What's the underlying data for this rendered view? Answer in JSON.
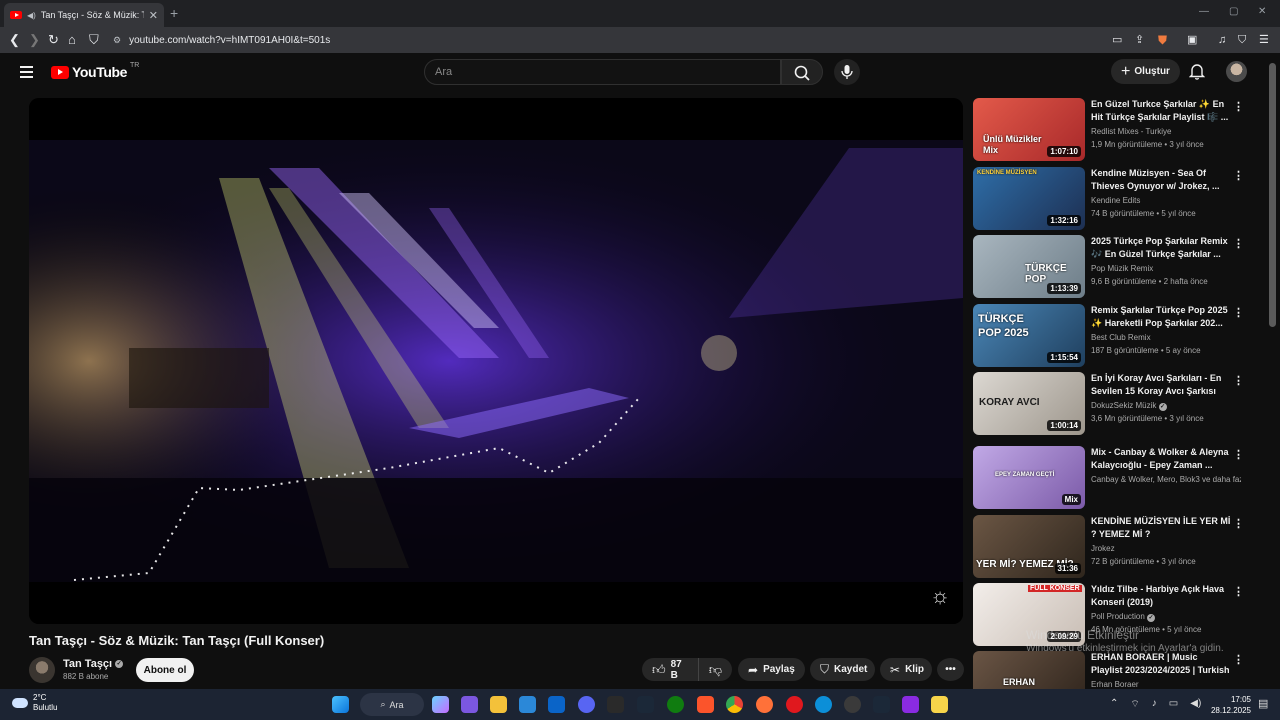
{
  "browser": {
    "tab_title": "Tan Taşçı - Söz & Müzik: Tan",
    "url": "youtube.com/watch?v=hIMT091AH0I&t=501s"
  },
  "masthead": {
    "logo_text": "YouTube",
    "country_code": "TR",
    "search_placeholder": "Ara",
    "create_label": "Oluştur"
  },
  "video": {
    "title": "Tan Taşçı - Söz & Müzik: Tan Taşçı (Full Konser)",
    "channel": "Tan Taşçı",
    "subscribers": "882 B abone",
    "subscribe_label": "Abone ol",
    "likes": "87 B",
    "share_label": "Paylaş",
    "save_label": "Kaydet",
    "clip_label": "Klip"
  },
  "recommendations": [
    {
      "title": "En Güzel Turkce Şarkılar ✨ En Hit Türkçe Şarkılar Playlist 🎼 ...",
      "channel": "Redlist Mixes - Turkiye",
      "meta": "1,9 Mn görüntüleme • 3 yıl önce",
      "duration": "1:07:10",
      "thumb_text": "Ünlü Müzikler Mix",
      "color": "#d9534f"
    },
    {
      "title": "Kendine Müzisyen - Sea Of Thieves Oynuyor w/ Jrokez, ...",
      "channel": "Kendine Edits",
      "meta": "74 B görüntüleme • 5 yıl önce",
      "duration": "1:32:16",
      "thumb_text": "KENDİNE MÜZİSYEN",
      "color": "#3a5f8a"
    },
    {
      "title": "2025 Türkçe Pop Şarkılar Remix 🎶 En Güzel Türkçe Şarkılar ...",
      "channel": "Pop Müzik Remix",
      "meta": "9,6 B görüntüleme • 2 hafta önce",
      "duration": "1:13:39",
      "thumb_text": "TÜRKÇE POP",
      "color": "#8a9aa8"
    },
    {
      "title": "Remix Şarkılar Türkçe Pop 2025 ✨ Hareketli Pop Şarkılar 202...",
      "channel": "Best Club Remix",
      "meta": "187 B görüntüleme • 5 ay önce",
      "duration": "1:15:54",
      "thumb_text": "TÜRKÇE POP 2025",
      "color": "#3f6b8f"
    },
    {
      "title": "En İyi Koray Avcı Şarkıları - En Sevilen 15 Koray Avcı Şarkısı",
      "channel": "DokuzSekiz Müzik",
      "meta": "3,6 Mn görüntüleme • 3 yıl önce",
      "duration": "1:00:14",
      "thumb_text": "KORAY AVCI",
      "color": "#c9c4bd"
    },
    {
      "title": "Mix - Canbay & Wolker & Aleyna Kalaycıoğlu - Epey Zaman ...",
      "channel": "Canbay & Wolker, Mero, Blok3 ve daha fazlası",
      "meta": "",
      "duration": "Mix",
      "thumb_text": "EPEY ZAMAN GEÇTİ",
      "color": "#a98fc8"
    },
    {
      "title": "KENDİNE MÜZİSYEN İLE YER Mİ ? YEMEZ Mİ ?",
      "channel": "Jrokez",
      "meta": "72 B görüntüleme • 3 yıl önce",
      "duration": "31:36",
      "thumb_text": "YER Mİ? YEMEZ Mİ?",
      "color": "#5a4a3a"
    },
    {
      "title": "Yıldız Tilbe - Harbiye Açık Hava Konseri (2019)",
      "channel": "Poll Production",
      "meta": "46 Mn görüntüleme • 5 yıl önce",
      "duration": "2:09:29",
      "thumb_text": "FULL KONSER",
      "color": "#e8e2dc"
    },
    {
      "title": "ERHAN BORAER | Music Playlist 2023/2024/2025 | Turkish & ...",
      "channel": "Erhan Boraer",
      "meta": "",
      "duration": "",
      "thumb_text": "ERHAN",
      "color": "#4a3a2a"
    }
  ],
  "watermark": {
    "line1": "Windows'u Etkinleştir",
    "line2": "Windows'u etkinleştirmek için Ayarlar'a gidin."
  },
  "taskbar": {
    "temperature": "2°C",
    "weather": "Bulutlu",
    "search_label": "Ara",
    "time": "17:05",
    "date": "28.12.2025"
  }
}
